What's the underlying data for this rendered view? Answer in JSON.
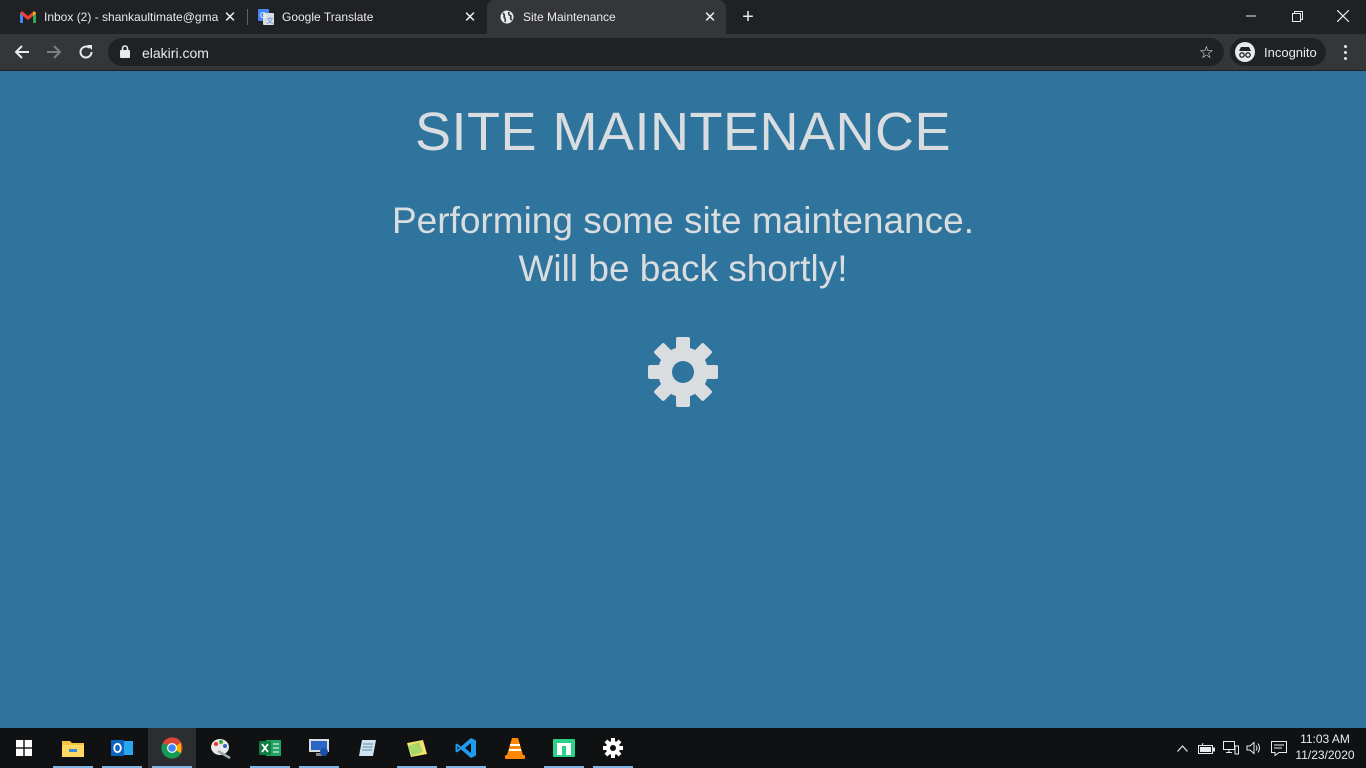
{
  "browser": {
    "tabs": [
      {
        "title": "Inbox (2) - shankaultimate@gma",
        "favicon": "gmail-icon",
        "active": false
      },
      {
        "title": "Google Translate",
        "favicon": "google-translate-icon",
        "active": false
      },
      {
        "title": "Site Maintenance",
        "favicon": "globe-icon",
        "active": true
      }
    ],
    "url": "elakiri.com",
    "profile_label": "Incognito"
  },
  "page": {
    "heading": "SITE MAINTENANCE",
    "line1": "Performing some site maintenance.",
    "line2": "Will be back shortly!",
    "icon": "gear-icon",
    "background_color": "#2e749d",
    "text_color": "#d9dde0"
  },
  "taskbar": {
    "apps": [
      "start-icon",
      "file-explorer-icon",
      "outlook-icon",
      "chrome-icon",
      "paint-icon",
      "excel-icon",
      "remote-desktop-icon",
      "notepad-icon",
      "sticky-notes-icon",
      "vscode-icon",
      "vlc-icon",
      "spreadsheet-app-icon",
      "settings-icon"
    ],
    "time": "11:03 AM",
    "date": "11/23/2020"
  }
}
